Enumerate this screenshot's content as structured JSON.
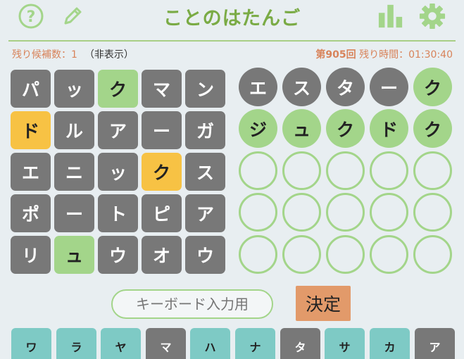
{
  "header": {
    "title": "ことのはたんご",
    "icons": {
      "help": "question-circle-icon",
      "edit": "pencil-icon",
      "stats": "bar-chart-icon",
      "settings": "gear-icon"
    },
    "colors": {
      "accent": "#7aab45",
      "line": "#a9cf86"
    }
  },
  "status": {
    "candidates_label": "残り候補数：1",
    "hidden_label": "（非表示）",
    "round": "第905回",
    "time_label": "残り時間：01:30:40"
  },
  "grid": {
    "rows": [
      [
        {
          "ch": "パ",
          "state": "gray"
        },
        {
          "ch": "ッ",
          "state": "gray"
        },
        {
          "ch": "ク",
          "state": "green"
        },
        {
          "ch": "マ",
          "state": "gray"
        },
        {
          "ch": "ン",
          "state": "gray"
        }
      ],
      [
        {
          "ch": "ド",
          "state": "yellow"
        },
        {
          "ch": "ル",
          "state": "gray"
        },
        {
          "ch": "ア",
          "state": "gray"
        },
        {
          "ch": "ー",
          "state": "gray"
        },
        {
          "ch": "ガ",
          "state": "gray"
        }
      ],
      [
        {
          "ch": "エ",
          "state": "gray"
        },
        {
          "ch": "ニ",
          "state": "gray"
        },
        {
          "ch": "ッ",
          "state": "gray"
        },
        {
          "ch": "ク",
          "state": "yellow"
        },
        {
          "ch": "ス",
          "state": "gray"
        }
      ],
      [
        {
          "ch": "ポ",
          "state": "gray"
        },
        {
          "ch": "ー",
          "state": "gray"
        },
        {
          "ch": "ト",
          "state": "gray"
        },
        {
          "ch": "ピ",
          "state": "gray"
        },
        {
          "ch": "ア",
          "state": "gray"
        }
      ],
      [
        {
          "ch": "リ",
          "state": "gray"
        },
        {
          "ch": "ュ",
          "state": "green"
        },
        {
          "ch": "ウ",
          "state": "gray"
        },
        {
          "ch": "オ",
          "state": "gray"
        },
        {
          "ch": "ウ",
          "state": "gray"
        }
      ]
    ],
    "colors": {
      "gray": "#787878",
      "green": "#a3d58a",
      "yellow": "#f7c244"
    }
  },
  "guesses": {
    "rows": [
      [
        {
          "ch": "エ",
          "state": "gray"
        },
        {
          "ch": "ス",
          "state": "gray"
        },
        {
          "ch": "タ",
          "state": "gray"
        },
        {
          "ch": "ー",
          "state": "gray"
        },
        {
          "ch": "ク",
          "state": "green"
        }
      ],
      [
        {
          "ch": "ジ",
          "state": "green"
        },
        {
          "ch": "ュ",
          "state": "green"
        },
        {
          "ch": "ク",
          "state": "green"
        },
        {
          "ch": "ド",
          "state": "green"
        },
        {
          "ch": "ク",
          "state": "green"
        }
      ],
      [
        {
          "ch": "",
          "state": "empty"
        },
        {
          "ch": "",
          "state": "empty"
        },
        {
          "ch": "",
          "state": "empty"
        },
        {
          "ch": "",
          "state": "empty"
        },
        {
          "ch": "",
          "state": "empty"
        }
      ],
      [
        {
          "ch": "",
          "state": "empty"
        },
        {
          "ch": "",
          "state": "empty"
        },
        {
          "ch": "",
          "state": "empty"
        },
        {
          "ch": "",
          "state": "empty"
        },
        {
          "ch": "",
          "state": "empty"
        }
      ],
      [
        {
          "ch": "",
          "state": "empty"
        },
        {
          "ch": "",
          "state": "empty"
        },
        {
          "ch": "",
          "state": "empty"
        },
        {
          "ch": "",
          "state": "empty"
        },
        {
          "ch": "",
          "state": "empty"
        }
      ]
    ]
  },
  "input": {
    "placeholder": "キーボード入力用",
    "submit_label": "決定"
  },
  "keyboard": {
    "keys": [
      {
        "ch": "ワ",
        "state": "teal"
      },
      {
        "ch": "ラ",
        "state": "teal"
      },
      {
        "ch": "ヤ",
        "state": "teal"
      },
      {
        "ch": "マ",
        "state": "gray"
      },
      {
        "ch": "ハ",
        "state": "teal"
      },
      {
        "ch": "ナ",
        "state": "teal"
      },
      {
        "ch": "タ",
        "state": "gray"
      },
      {
        "ch": "サ",
        "state": "teal"
      },
      {
        "ch": "カ",
        "state": "teal"
      },
      {
        "ch": "ア",
        "state": "gray"
      }
    ],
    "colors": {
      "teal": "#7ecac5",
      "gray": "#787878"
    }
  }
}
